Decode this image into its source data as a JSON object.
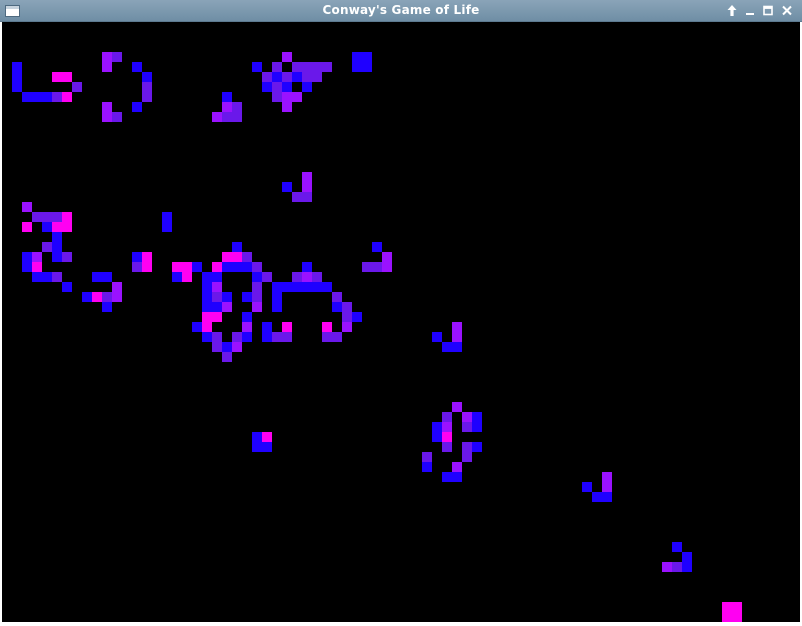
{
  "window": {
    "title": "Conway's Game of Life",
    "controls": [
      {
        "name": "always-on-top-icon"
      },
      {
        "name": "minimize-icon"
      },
      {
        "name": "maximize-icon"
      },
      {
        "name": "close-icon"
      }
    ]
  },
  "board": {
    "background": "#000000",
    "palette": {
      "b": "#1f00ff",
      "i": "#6a18ea",
      "v": "#9a12ff",
      "m": "#ff00f2"
    },
    "cells": [
      [
        28,
        3,
        "v"
      ],
      [
        29,
        4,
        "i"
      ],
      [
        30,
        4,
        "i"
      ],
      [
        27,
        4,
        "i"
      ],
      [
        10,
        3,
        "v"
      ],
      [
        11,
        3,
        "i"
      ],
      [
        10,
        4,
        "v"
      ],
      [
        35,
        3,
        "b"
      ],
      [
        36,
        3,
        "b"
      ],
      [
        35,
        4,
        "b"
      ],
      [
        36,
        4,
        "b"
      ],
      [
        1,
        4,
        "b"
      ],
      [
        13,
        4,
        "b"
      ],
      [
        25,
        4,
        "b"
      ],
      [
        27,
        5,
        "b"
      ],
      [
        28,
        5,
        "b"
      ],
      [
        29,
        5,
        "b"
      ],
      [
        31,
        4,
        "i"
      ],
      [
        32,
        4,
        "i"
      ],
      [
        5,
        5,
        "m"
      ],
      [
        6,
        5,
        "m"
      ],
      [
        14,
        5,
        "b"
      ],
      [
        26,
        5,
        "i"
      ],
      [
        28,
        5,
        "i"
      ],
      [
        30,
        5,
        "i"
      ],
      [
        1,
        5,
        "b"
      ],
      [
        14,
        6,
        "i"
      ],
      [
        1,
        6,
        "b"
      ],
      [
        7,
        6,
        "i"
      ],
      [
        26,
        6,
        "b"
      ],
      [
        28,
        6,
        "b"
      ],
      [
        30,
        6,
        "b"
      ],
      [
        27,
        6,
        "i"
      ],
      [
        31,
        5,
        "i"
      ],
      [
        2,
        7,
        "b"
      ],
      [
        3,
        7,
        "b"
      ],
      [
        4,
        7,
        "b"
      ],
      [
        5,
        7,
        "i"
      ],
      [
        6,
        7,
        "m"
      ],
      [
        14,
        7,
        "i"
      ],
      [
        22,
        7,
        "b"
      ],
      [
        27,
        7,
        "i"
      ],
      [
        28,
        7,
        "v"
      ],
      [
        29,
        7,
        "v"
      ],
      [
        10,
        8,
        "v"
      ],
      [
        13,
        8,
        "b"
      ],
      [
        22,
        8,
        "v"
      ],
      [
        23,
        8,
        "i"
      ],
      [
        28,
        8,
        "v"
      ],
      [
        10,
        9,
        "v"
      ],
      [
        11,
        9,
        "i"
      ],
      [
        21,
        9,
        "v"
      ],
      [
        22,
        9,
        "i"
      ],
      [
        23,
        9,
        "i"
      ],
      [
        30,
        15,
        "v"
      ],
      [
        28,
        16,
        "b"
      ],
      [
        30,
        16,
        "v"
      ],
      [
        29,
        17,
        "i"
      ],
      [
        30,
        17,
        "i"
      ],
      [
        2,
        18,
        "v"
      ],
      [
        3,
        19,
        "i"
      ],
      [
        4,
        19,
        "i"
      ],
      [
        5,
        19,
        "i"
      ],
      [
        6,
        19,
        "m"
      ],
      [
        16,
        19,
        "b"
      ],
      [
        2,
        20,
        "m"
      ],
      [
        4,
        20,
        "b"
      ],
      [
        5,
        20,
        "m"
      ],
      [
        6,
        20,
        "m"
      ],
      [
        16,
        20,
        "b"
      ],
      [
        5,
        21,
        "b"
      ],
      [
        4,
        22,
        "i"
      ],
      [
        5,
        22,
        "b"
      ],
      [
        23,
        22,
        "b"
      ],
      [
        37,
        22,
        "b"
      ],
      [
        2,
        23,
        "b"
      ],
      [
        3,
        23,
        "v"
      ],
      [
        5,
        23,
        "b"
      ],
      [
        6,
        23,
        "i"
      ],
      [
        13,
        23,
        "b"
      ],
      [
        14,
        23,
        "m"
      ],
      [
        22,
        23,
        "m"
      ],
      [
        23,
        23,
        "m"
      ],
      [
        24,
        23,
        "i"
      ],
      [
        38,
        23,
        "v"
      ],
      [
        2,
        24,
        "b"
      ],
      [
        3,
        24,
        "m"
      ],
      [
        13,
        24,
        "i"
      ],
      [
        14,
        24,
        "m"
      ],
      [
        17,
        24,
        "m"
      ],
      [
        18,
        24,
        "m"
      ],
      [
        19,
        24,
        "b"
      ],
      [
        21,
        24,
        "m"
      ],
      [
        22,
        24,
        "b"
      ],
      [
        23,
        24,
        "b"
      ],
      [
        24,
        24,
        "b"
      ],
      [
        25,
        24,
        "i"
      ],
      [
        30,
        24,
        "b"
      ],
      [
        36,
        24,
        "i"
      ],
      [
        37,
        24,
        "i"
      ],
      [
        38,
        24,
        "v"
      ],
      [
        3,
        25,
        "b"
      ],
      [
        4,
        25,
        "b"
      ],
      [
        5,
        25,
        "i"
      ],
      [
        9,
        25,
        "b"
      ],
      [
        10,
        25,
        "b"
      ],
      [
        17,
        25,
        "b"
      ],
      [
        18,
        25,
        "m"
      ],
      [
        20,
        25,
        "b"
      ],
      [
        21,
        25,
        "b"
      ],
      [
        25,
        25,
        "b"
      ],
      [
        26,
        25,
        "i"
      ],
      [
        29,
        25,
        "i"
      ],
      [
        30,
        25,
        "v"
      ],
      [
        31,
        25,
        "i"
      ],
      [
        6,
        26,
        "b"
      ],
      [
        11,
        26,
        "v"
      ],
      [
        20,
        26,
        "b"
      ],
      [
        21,
        26,
        "v"
      ],
      [
        25,
        26,
        "i"
      ],
      [
        27,
        26,
        "b"
      ],
      [
        28,
        26,
        "b"
      ],
      [
        29,
        26,
        "b"
      ],
      [
        30,
        26,
        "b"
      ],
      [
        31,
        26,
        "b"
      ],
      [
        32,
        26,
        "b"
      ],
      [
        8,
        27,
        "b"
      ],
      [
        9,
        27,
        "m"
      ],
      [
        10,
        27,
        "i"
      ],
      [
        11,
        27,
        "v"
      ],
      [
        20,
        27,
        "b"
      ],
      [
        21,
        27,
        "i"
      ],
      [
        22,
        27,
        "b"
      ],
      [
        24,
        27,
        "b"
      ],
      [
        25,
        27,
        "i"
      ],
      [
        27,
        27,
        "b"
      ],
      [
        33,
        27,
        "i"
      ],
      [
        10,
        28,
        "b"
      ],
      [
        20,
        28,
        "b"
      ],
      [
        21,
        28,
        "b"
      ],
      [
        22,
        28,
        "v"
      ],
      [
        25,
        28,
        "v"
      ],
      [
        27,
        28,
        "b"
      ],
      [
        33,
        28,
        "b"
      ],
      [
        34,
        28,
        "i"
      ],
      [
        20,
        29,
        "m"
      ],
      [
        21,
        29,
        "m"
      ],
      [
        24,
        29,
        "b"
      ],
      [
        34,
        29,
        "i"
      ],
      [
        35,
        29,
        "b"
      ],
      [
        19,
        30,
        "b"
      ],
      [
        20,
        30,
        "m"
      ],
      [
        24,
        30,
        "v"
      ],
      [
        26,
        30,
        "b"
      ],
      [
        28,
        30,
        "m"
      ],
      [
        32,
        30,
        "m"
      ],
      [
        34,
        30,
        "v"
      ],
      [
        45,
        30,
        "v"
      ],
      [
        20,
        31,
        "b"
      ],
      [
        21,
        31,
        "i"
      ],
      [
        23,
        31,
        "i"
      ],
      [
        24,
        31,
        "b"
      ],
      [
        26,
        31,
        "b"
      ],
      [
        27,
        31,
        "i"
      ],
      [
        28,
        31,
        "i"
      ],
      [
        32,
        31,
        "i"
      ],
      [
        33,
        31,
        "i"
      ],
      [
        43,
        31,
        "b"
      ],
      [
        45,
        31,
        "v"
      ],
      [
        21,
        32,
        "i"
      ],
      [
        22,
        32,
        "b"
      ],
      [
        23,
        32,
        "v"
      ],
      [
        44,
        32,
        "b"
      ],
      [
        45,
        32,
        "b"
      ],
      [
        22,
        33,
        "i"
      ],
      [
        45,
        38,
        "v"
      ],
      [
        44,
        39,
        "i"
      ],
      [
        46,
        39,
        "v"
      ],
      [
        47,
        39,
        "b"
      ],
      [
        43,
        40,
        "b"
      ],
      [
        44,
        40,
        "v"
      ],
      [
        46,
        40,
        "i"
      ],
      [
        47,
        40,
        "b"
      ],
      [
        25,
        41,
        "b"
      ],
      [
        26,
        41,
        "m"
      ],
      [
        43,
        41,
        "b"
      ],
      [
        44,
        41,
        "m"
      ],
      [
        25,
        42,
        "b"
      ],
      [
        26,
        42,
        "b"
      ],
      [
        44,
        42,
        "i"
      ],
      [
        46,
        42,
        "i"
      ],
      [
        47,
        42,
        "b"
      ],
      [
        42,
        43,
        "i"
      ],
      [
        46,
        43,
        "i"
      ],
      [
        42,
        44,
        "b"
      ],
      [
        45,
        44,
        "v"
      ],
      [
        44,
        45,
        "b"
      ],
      [
        45,
        45,
        "b"
      ],
      [
        60,
        45,
        "v"
      ],
      [
        58,
        46,
        "b"
      ],
      [
        60,
        46,
        "v"
      ],
      [
        59,
        47,
        "b"
      ],
      [
        60,
        47,
        "b"
      ],
      [
        67,
        52,
        "b"
      ],
      [
        68,
        53,
        "b"
      ],
      [
        66,
        54,
        "v"
      ],
      [
        67,
        54,
        "i"
      ],
      [
        68,
        54,
        "b"
      ],
      [
        72,
        58,
        "m"
      ],
      [
        73,
        58,
        "m"
      ],
      [
        72,
        59,
        "m"
      ],
      [
        73,
        59,
        "m"
      ]
    ]
  }
}
